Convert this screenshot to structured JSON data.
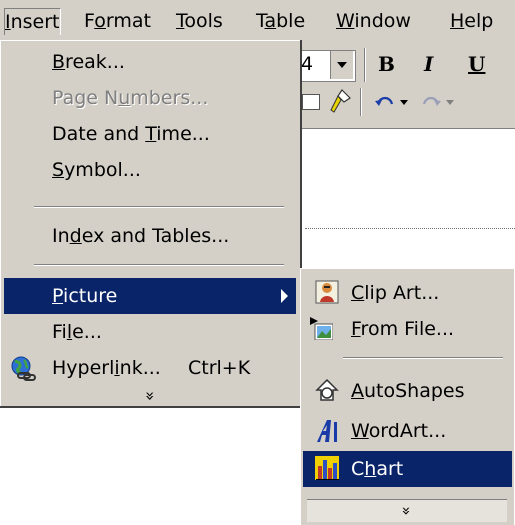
{
  "menubar": {
    "items": [
      {
        "pre": "",
        "acc": "I",
        "post": "nsert"
      },
      {
        "pre": "F",
        "acc": "o",
        "post": "rmat"
      },
      {
        "pre": "",
        "acc": "T",
        "post": "ools"
      },
      {
        "pre": "T",
        "acc": "a",
        "post": "ble"
      },
      {
        "pre": "",
        "acc": "W",
        "post": "indow"
      },
      {
        "pre": "",
        "acc": "H",
        "post": "elp"
      }
    ]
  },
  "toolbar": {
    "font_size_fragment": "4",
    "bold": "B",
    "italic": "I",
    "underline": "U"
  },
  "insert_menu": {
    "items": [
      {
        "pre": "",
        "acc": "B",
        "post": "reak..."
      },
      {
        "pre": "Page N",
        "acc": "u",
        "post": "mbers..."
      },
      {
        "pre": "Date and ",
        "acc": "T",
        "post": "ime..."
      },
      {
        "pre": "",
        "acc": "S",
        "post": "ymbol..."
      },
      {
        "pre": "In",
        "acc": "d",
        "post": "ex and Tables..."
      },
      {
        "pre": "",
        "acc": "P",
        "post": "icture"
      },
      {
        "pre": "Fi",
        "acc": "l",
        "post": "e..."
      },
      {
        "pre": "Hyperl",
        "acc": "i",
        "post": "nk...",
        "shortcut": "Ctrl+K"
      }
    ],
    "more": "»"
  },
  "picture_submenu": {
    "items": [
      {
        "pre": "",
        "acc": "C",
        "post": "lip Art...",
        "icon": "clip-art-icon"
      },
      {
        "pre": "",
        "acc": "F",
        "post": "rom File...",
        "icon": "from-file-icon"
      },
      {
        "pre": "",
        "acc": "A",
        "post": "utoShapes",
        "icon": "autoshapes-icon"
      },
      {
        "pre": "",
        "acc": "W",
        "post": "ordArt...",
        "icon": "wordart-icon"
      },
      {
        "pre": "C",
        "acc": "h",
        "post": "art",
        "icon": "chart-icon"
      }
    ],
    "more": "»"
  },
  "colors": {
    "menu_bg": "#d4d0c8",
    "highlight": "#0a246a",
    "disabled": "#808080"
  }
}
